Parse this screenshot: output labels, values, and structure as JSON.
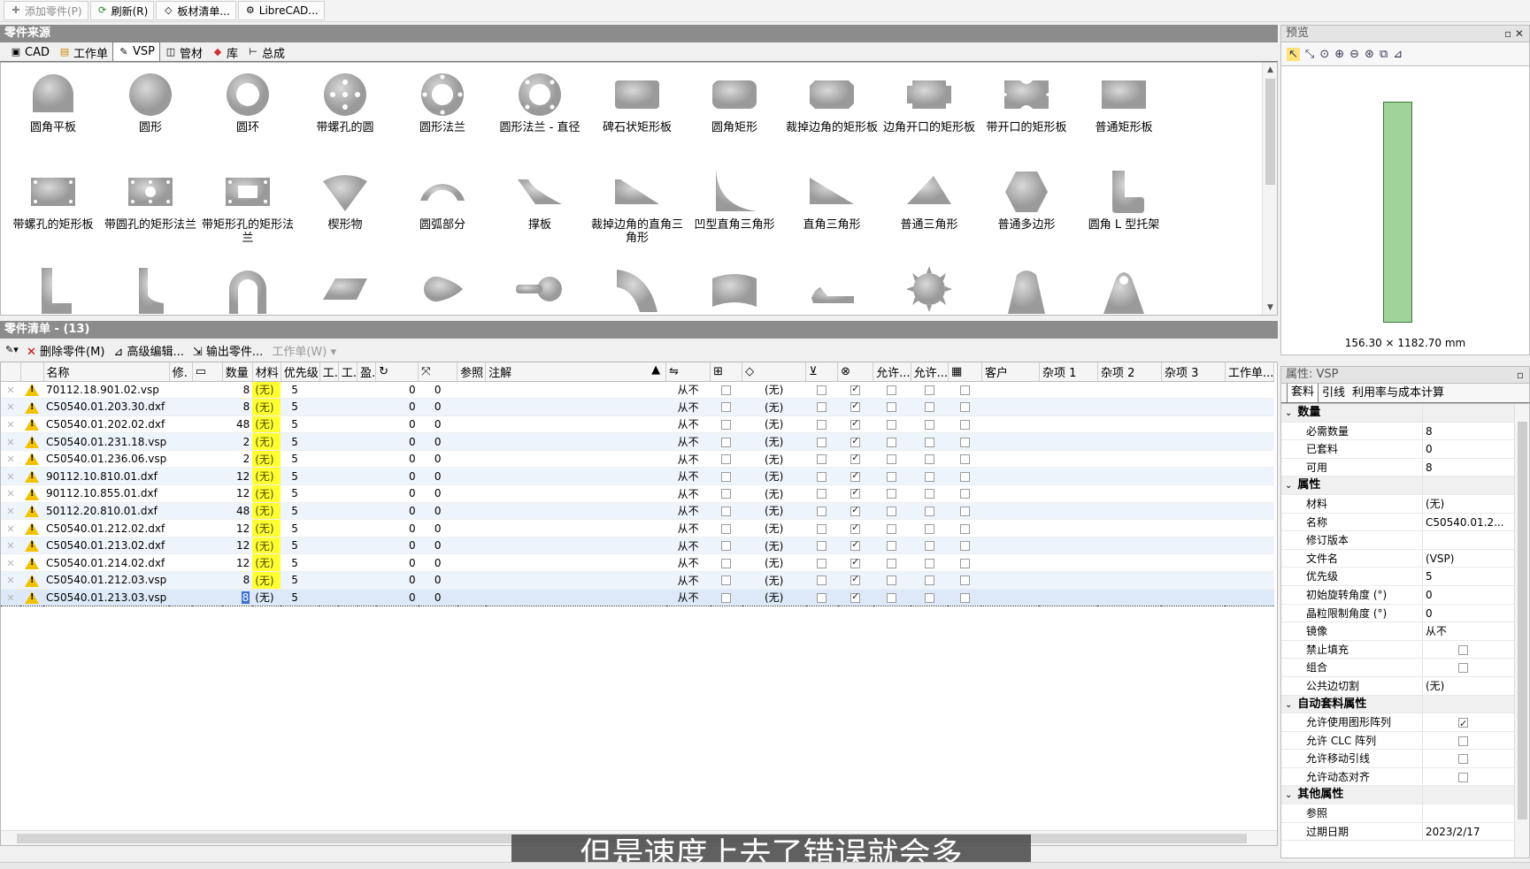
{
  "toolbar": {
    "add_part": "添加零件(P)",
    "refresh": "刷新(R)",
    "sheet_list": "板材清单...",
    "librecad": "LibreCAD..."
  },
  "source_panel": {
    "title": "零件来源",
    "tabs": [
      "CAD",
      "工作单",
      "VSP",
      "管材",
      "库",
      "总成"
    ],
    "active_tab": "VSP",
    "shapes_row1": [
      "圆角平板",
      "圆形",
      "圆环",
      "带螺孔的圆",
      "圆形法兰",
      "圆形法兰 - 直径",
      "碑石状矩形板",
      "圆角矩形",
      "裁掉边角的矩形板",
      "边角开口的矩形板",
      "带开口的矩形板",
      "普通矩形板"
    ],
    "shapes_row2": [
      "带螺孔的矩形板",
      "带圆孔的矩形法兰",
      "带矩形孔的矩形法兰",
      "楔形物",
      "圆弧部分",
      "撑板",
      "裁掉边角的直角三角形",
      "凹型直角三角形",
      "直角三角形",
      "普通三角形",
      "普通多边形",
      "圆角 L 型托架"
    ]
  },
  "part_list": {
    "title": "零件清单 - (13)",
    "tools": {
      "delete": "删除零件(M)",
      "advanced": "高级编辑...",
      "export": "输出零件...",
      "worklist": "工作单(W)"
    },
    "headers": {
      "name": "名称",
      "rev": "修.",
      "qty": "数量",
      "material": "材料",
      "priority": "优先级",
      "t1": "工.",
      "t2": "工.",
      "t3": "盈.",
      "ref": "参照",
      "note": "注解",
      "allow1": "允许...",
      "allow2": "允许...",
      "customer": "客户",
      "misc1": "杂项 1",
      "misc2": "杂项 2",
      "misc3": "杂项 3",
      "worksheet": "工作单..."
    },
    "rows": [
      {
        "name": "70112.18.901.02.vsp",
        "qty": "8",
        "material": "(无)",
        "priority": "5",
        "rot": "0",
        "grain": "0",
        "mirror": "从不",
        "layer": "(无)",
        "c1": false,
        "c3": true
      },
      {
        "name": "C50540.01.203.30.dxf",
        "qty": "8",
        "material": "(无)",
        "priority": "5",
        "rot": "0",
        "grain": "0",
        "mirror": "从不",
        "layer": "(无)",
        "c1": false,
        "c3": true
      },
      {
        "name": "C50540.01.202.02.dxf",
        "qty": "48",
        "material": "(无)",
        "priority": "5",
        "rot": "0",
        "grain": "0",
        "mirror": "从不",
        "layer": "(无)",
        "c1": false,
        "c3": true
      },
      {
        "name": "C50540.01.231.18.vsp",
        "qty": "2",
        "material": "(无)",
        "priority": "5",
        "rot": "0",
        "grain": "0",
        "mirror": "从不",
        "layer": "(无)",
        "c1": false,
        "c3": true
      },
      {
        "name": "C50540.01.236.06.vsp",
        "qty": "2",
        "material": "(无)",
        "priority": "5",
        "rot": "0",
        "grain": "0",
        "mirror": "从不",
        "layer": "(无)",
        "c1": false,
        "c3": true
      },
      {
        "name": "90112.10.810.01.dxf",
        "qty": "12",
        "material": "(无)",
        "priority": "5",
        "rot": "0",
        "grain": "0",
        "mirror": "从不",
        "layer": "(无)",
        "c1": false,
        "c3": true
      },
      {
        "name": "90112.10.855.01.dxf",
        "qty": "12",
        "material": "(无)",
        "priority": "5",
        "rot": "0",
        "grain": "0",
        "mirror": "从不",
        "layer": "(无)",
        "c1": false,
        "c3": true
      },
      {
        "name": "50112.20.810.01.dxf",
        "qty": "48",
        "material": "(无)",
        "priority": "5",
        "rot": "0",
        "grain": "0",
        "mirror": "从不",
        "layer": "(无)",
        "c1": false,
        "c3": true
      },
      {
        "name": "C50540.01.212.02.dxf",
        "qty": "12",
        "material": "(无)",
        "priority": "5",
        "rot": "0",
        "grain": "0",
        "mirror": "从不",
        "layer": "(无)",
        "c1": false,
        "c3": true
      },
      {
        "name": "C50540.01.213.02.dxf",
        "qty": "12",
        "material": "(无)",
        "priority": "5",
        "rot": "0",
        "grain": "0",
        "mirror": "从不",
        "layer": "(无)",
        "c1": false,
        "c3": true
      },
      {
        "name": "C50540.01.214.02.dxf",
        "qty": "12",
        "material": "(无)",
        "priority": "5",
        "rot": "0",
        "grain": "0",
        "mirror": "从不",
        "layer": "(无)",
        "c1": false,
        "c3": true
      },
      {
        "name": "C50540.01.212.03.vsp",
        "qty": "8",
        "material": "(无)",
        "priority": "5",
        "rot": "0",
        "grain": "0",
        "mirror": "从不",
        "layer": "(无)",
        "c1": false,
        "c3": true
      },
      {
        "name": "C50540.01.213.03.vsp",
        "qty": "8",
        "material": "(无)",
        "priority": "5",
        "rot": "0",
        "grain": "0",
        "mirror": "从不",
        "layer": "(无)",
        "c1": false,
        "c3": true
      }
    ],
    "selected_index": 12
  },
  "preview": {
    "title": "预览",
    "dimension": "156.30 × 1182.70 mm",
    "fill_color": "#9fd39a"
  },
  "properties": {
    "title": "属性: VSP",
    "tabs": [
      "套料",
      "引线",
      "利用率与成本计算"
    ],
    "groups": [
      {
        "name": "数量",
        "items": [
          {
            "k": "必需数量",
            "v": "8"
          },
          {
            "k": "已套料",
            "v": "0"
          },
          {
            "k": "可用",
            "v": "8"
          }
        ]
      },
      {
        "name": "属性",
        "items": [
          {
            "k": "材料",
            "v": "(无)"
          },
          {
            "k": "名称",
            "v": "C50540.01.2..."
          },
          {
            "k": "修订版本",
            "v": ""
          },
          {
            "k": "文件名",
            "v": "(VSP)"
          },
          {
            "k": "优先级",
            "v": "5"
          },
          {
            "k": "初始旋转角度 (°)",
            "v": "0"
          },
          {
            "k": "晶粒限制角度 (°)",
            "v": "0"
          },
          {
            "k": "镜像",
            "v": "从不"
          },
          {
            "k": "禁止填充",
            "v": "",
            "chk": false
          },
          {
            "k": "组合",
            "v": "",
            "chk": false
          },
          {
            "k": "公共边切割",
            "v": "(无)"
          }
        ]
      },
      {
        "name": "自动套料属性",
        "items": [
          {
            "k": "允许使用图形阵列",
            "v": "",
            "chk": true
          },
          {
            "k": "允许 CLC 阵列",
            "v": "",
            "chk": false
          },
          {
            "k": "允许移动引线",
            "v": "",
            "chk": false
          },
          {
            "k": "允许动态对齐",
            "v": "",
            "chk": false
          }
        ]
      },
      {
        "name": "其他属性",
        "items": [
          {
            "k": "参照",
            "v": ""
          },
          {
            "k": "过期日期",
            "v": "2023/2/17"
          }
        ]
      }
    ]
  },
  "subtitle": "但是速度上去了错误就会多"
}
